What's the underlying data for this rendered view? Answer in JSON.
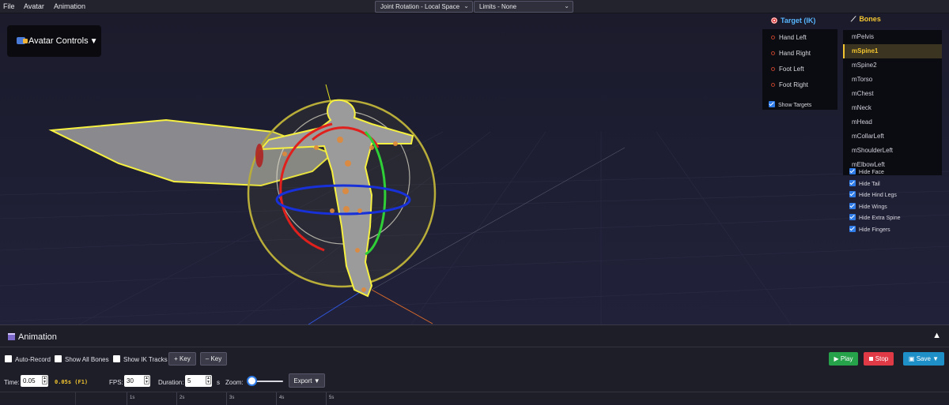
{
  "menu": [
    "File",
    "Avatar",
    "Animation"
  ],
  "toolbar": {
    "rotation_mode": "Joint Rotation - Local Space",
    "limits": "Limits - None"
  },
  "avatar_controls": {
    "label": "Avatar Controls"
  },
  "ik_panel": {
    "title": "Target (IK)",
    "targets": [
      "Hand Left",
      "Hand Right",
      "Foot Left",
      "Foot Right"
    ],
    "show_targets": "Show Targets"
  },
  "bones_panel": {
    "title": "Bones",
    "bones": [
      "mPelvis",
      "mSpine1",
      "mSpine2",
      "mTorso",
      "mChest",
      "mNeck",
      "mHead",
      "mCollarLeft",
      "mShoulderLeft",
      "mElbowLeft"
    ],
    "selected": "mSpine1",
    "hide_options": [
      "Hide Face",
      "Hide Tail",
      "Hide Hind Legs",
      "Hide Wings",
      "Hide Extra Spine",
      "Hide Fingers"
    ]
  },
  "animation": {
    "title": "Animation",
    "auto_record": "Auto-Record",
    "show_all_bones": "Show All Bones",
    "show_ik_tracks": "Show IK Tracks",
    "add_key": "+ Key",
    "remove_key": "– Key",
    "play": "Play",
    "stop": "Stop",
    "save": "Save",
    "time_label": "Time:",
    "time_value": "0.05",
    "time_display": "0.05s (F1)",
    "fps_label": "FPS:",
    "fps_value": "30",
    "duration_label": "Duration:",
    "duration_value": "5",
    "duration_unit": "s",
    "zoom_label": "Zoom:",
    "zoom_level": 0.1,
    "export": "Export",
    "timeline_ticks": [
      "1s",
      "2s",
      "3s",
      "4s",
      "5s"
    ]
  },
  "colors": {
    "accent_blue": "#2f7be8",
    "bones_title": "#f3c530",
    "ik_title": "#58b6ff",
    "play": "#26a24a",
    "stop": "#e03a46",
    "save": "#1f8fc8"
  }
}
